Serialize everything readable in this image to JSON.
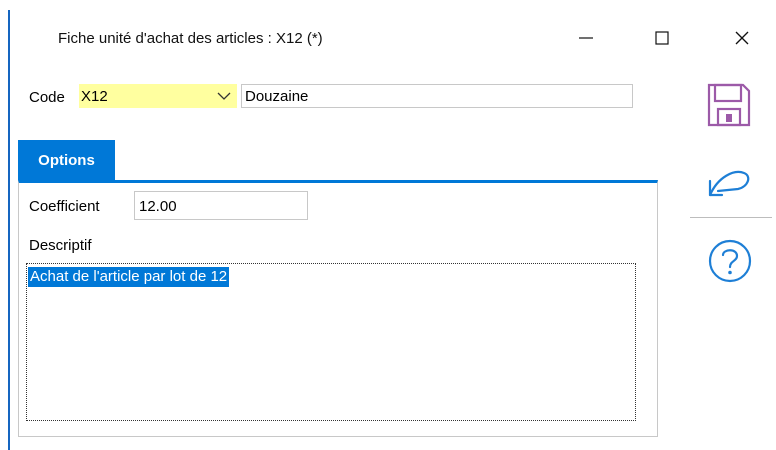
{
  "window": {
    "title": "Fiche unité d'achat des articles : X12 (*)"
  },
  "code": {
    "label": "Code",
    "value": "X12",
    "description": "Douzaine"
  },
  "tabs": [
    {
      "label": "Options",
      "active": true
    }
  ],
  "options": {
    "coefficient_label": "Coefficient",
    "coefficient_value": "12.00",
    "descriptif_label": "Descriptif",
    "descriptif_value": "Achat de l'article par lot de 12"
  },
  "colors": {
    "accent": "#0078d7",
    "code_field_bg": "#ffff9f",
    "save_icon": "#9c5aa8",
    "side_icons": "#1e7fd6"
  },
  "icons": {
    "save": "floppy-disk-icon",
    "undo": "undo-icon",
    "help": "question-icon",
    "minimize": "minimize-icon",
    "maximize": "maximize-icon",
    "close": "close-icon",
    "dropdown": "chevron-down-icon"
  }
}
